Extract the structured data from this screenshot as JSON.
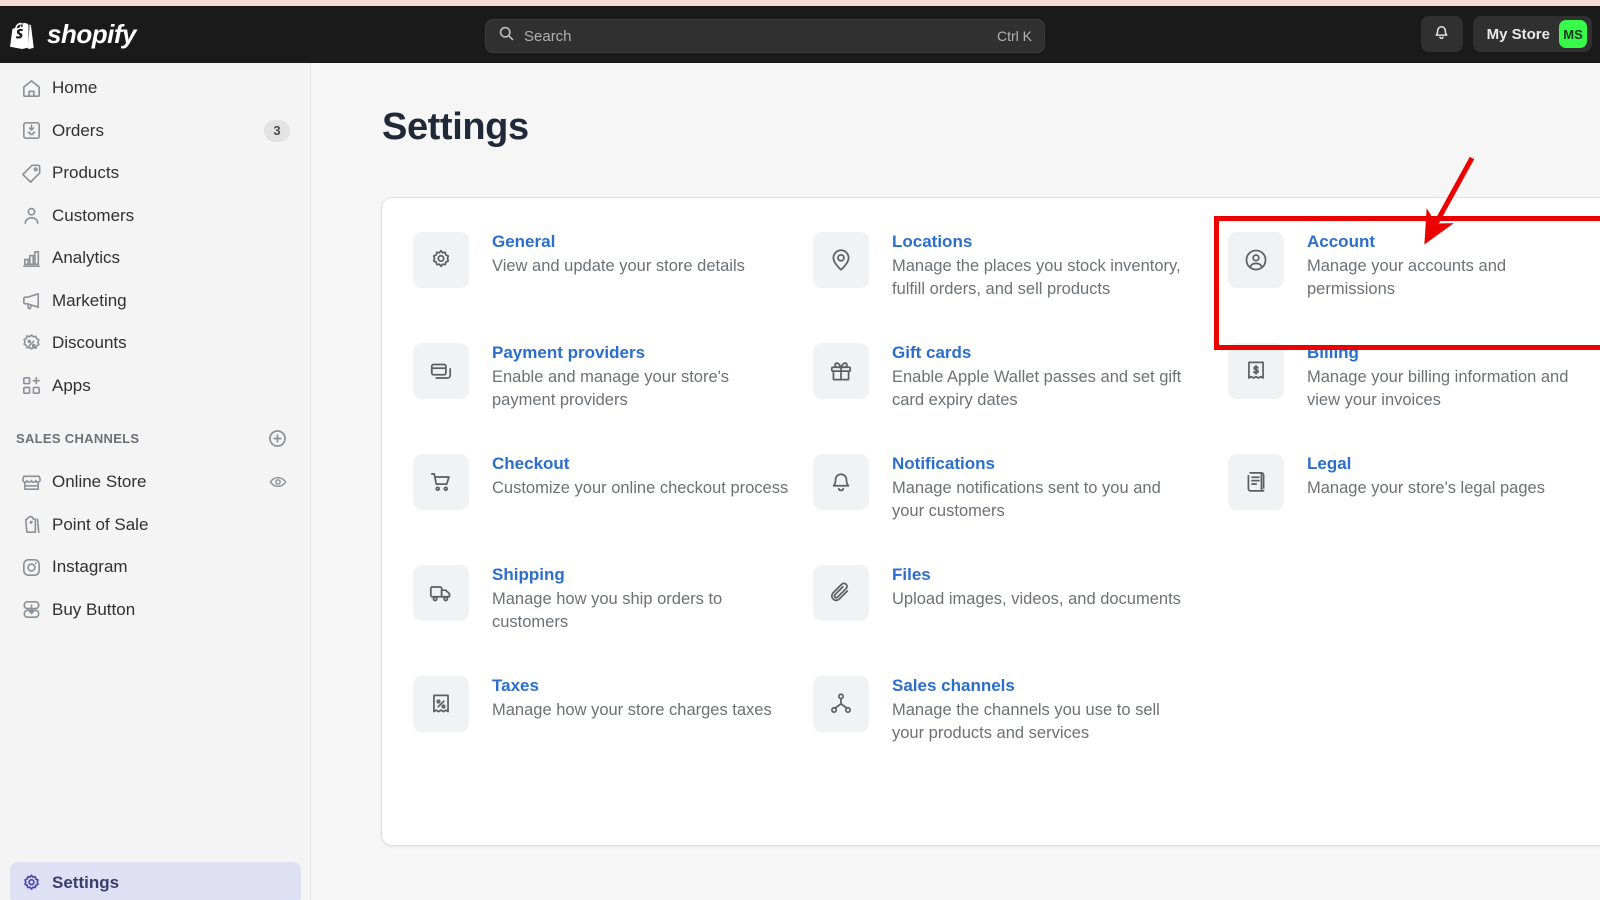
{
  "topbar": {
    "brand": "shopify",
    "brand_icon": "shopify-bag-logo",
    "search": {
      "placeholder": "Search",
      "value": "",
      "shortcut": "Ctrl K",
      "icon": "search-icon"
    },
    "notifications_icon": "bell-icon",
    "store_name": "My Store",
    "store_initials": "MS",
    "avatar_color": "#36fb48",
    "background": "#1a1a1a"
  },
  "sidebar": {
    "items": [
      {
        "label": "Home",
        "icon": "home-icon",
        "badge": ""
      },
      {
        "label": "Orders",
        "icon": "orders-inbox-icon",
        "badge": "3"
      },
      {
        "label": "Products",
        "icon": "tag-icon",
        "badge": ""
      },
      {
        "label": "Customers",
        "icon": "person-icon",
        "badge": ""
      },
      {
        "label": "Analytics",
        "icon": "bar-chart-icon",
        "badge": ""
      },
      {
        "label": "Marketing",
        "icon": "megaphone-icon",
        "badge": ""
      },
      {
        "label": "Discounts",
        "icon": "percent-badge-icon",
        "badge": ""
      },
      {
        "label": "Apps",
        "icon": "apps-grid-plus-icon",
        "badge": ""
      }
    ],
    "section": {
      "title": "SALES CHANNELS",
      "add_icon": "plus-circle-icon"
    },
    "channels": [
      {
        "label": "Online Store",
        "icon": "storefront-icon",
        "trailing_icon": "eye-icon"
      },
      {
        "label": "Point of Sale",
        "icon": "pos-bag-icon",
        "trailing_icon": ""
      },
      {
        "label": "Instagram",
        "icon": "instagram-icon",
        "trailing_icon": ""
      },
      {
        "label": "Buy Button",
        "icon": "buy-button-icon",
        "trailing_icon": ""
      }
    ],
    "footer": {
      "label": "Settings",
      "icon": "gear-icon",
      "active": true
    }
  },
  "main": {
    "title": "Settings",
    "settings": [
      {
        "title": "General",
        "desc": "View and update your store details",
        "icon": "gear-icon"
      },
      {
        "title": "Locations",
        "desc": "Manage the places you stock inventory, fulfill orders, and sell products",
        "icon": "location-pin-icon"
      },
      {
        "title": "Account",
        "desc": "Manage your accounts and permissions",
        "icon": "account-circle-icon"
      },
      {
        "title": "Payment providers",
        "desc": "Enable and manage your store's payment providers",
        "icon": "credit-card-icon"
      },
      {
        "title": "Gift cards",
        "desc": "Enable Apple Wallet passes and set gift card expiry dates",
        "icon": "gift-icon"
      },
      {
        "title": "Billing",
        "desc": "Manage your billing information and view your invoices",
        "icon": "receipt-dollar-icon"
      },
      {
        "title": "Checkout",
        "desc": "Customize your online checkout process",
        "icon": "shopping-cart-icon"
      },
      {
        "title": "Notifications",
        "desc": "Manage notifications sent to you and your customers",
        "icon": "bell-icon"
      },
      {
        "title": "Legal",
        "desc": "Manage your store's legal pages",
        "icon": "scroll-document-icon"
      },
      {
        "title": "Shipping",
        "desc": "Manage how you ship orders to customers",
        "icon": "truck-icon"
      },
      {
        "title": "Files",
        "desc": "Upload images, videos, and documents",
        "icon": "paperclip-icon"
      },
      {
        "title": "",
        "desc": "",
        "icon": ""
      },
      {
        "title": "Taxes",
        "desc": "Manage how your store charges taxes",
        "icon": "tax-receipt-icon"
      },
      {
        "title": "Sales channels",
        "desc": "Manage the channels you use to sell your products and services",
        "icon": "channels-node-icon"
      },
      {
        "title": "",
        "desc": "",
        "icon": ""
      }
    ],
    "link_color": "#2c6ecb",
    "desc_color": "#6d7175"
  },
  "annotation": {
    "color": "#ec0000",
    "highlight_target": "Account",
    "shapes": [
      "rectangle-highlight",
      "arrow-pointer"
    ]
  }
}
